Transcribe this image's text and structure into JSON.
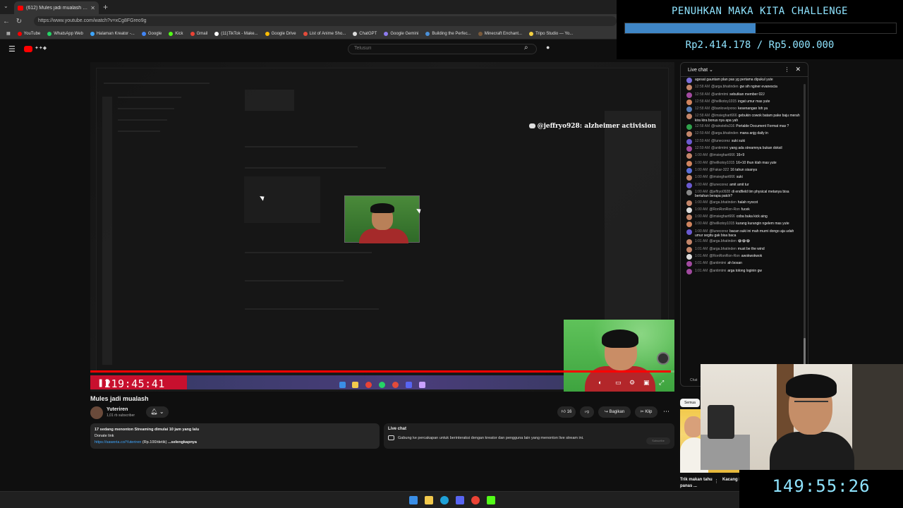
{
  "browser": {
    "tab_title": "(612) Mules jadi mualash - YouTube",
    "url": "https://www.youtube.com/watch?v=xCg8FGreo9g",
    "bookmarks": [
      {
        "label": "YouTube",
        "color": "#ff0000"
      },
      {
        "label": "WhatsApp Web",
        "color": "#25d366"
      },
      {
        "label": "Halaman Kreator -...",
        "color": "#3ea6ff"
      },
      {
        "label": "Google",
        "color": "#4285f4"
      },
      {
        "label": "Kick",
        "color": "#53fc18"
      },
      {
        "label": "Gmail",
        "color": "#ea4335"
      },
      {
        "label": "(11)TikTok - Make...",
        "color": "#ffffff"
      },
      {
        "label": "Google Drive",
        "color": "#fbbc04"
      },
      {
        "label": "List of Anime Sho...",
        "color": "#e34b3a"
      },
      {
        "label": "ChatGPT",
        "color": "#dddddd"
      },
      {
        "label": "Google Gemini",
        "color": "#8e7cf0"
      },
      {
        "label": "Building the Perfec...",
        "color": "#4a90d9"
      },
      {
        "label": "Minecraft Enchant...",
        "color": "#7a5a3a"
      },
      {
        "label": "Tripo Studio — Yo...",
        "color": "#f5d142"
      }
    ]
  },
  "youtube": {
    "search_placeholder": "Telusuri"
  },
  "video": {
    "overlay_name": "@jeffryo928: alzheimer activision",
    "timer": "219:45:41",
    "progress_fraction": 0.994,
    "title": "Mules jadi mualash",
    "channel_name": "Yuteriren",
    "channel_subs": "1,01 rb subscriber",
    "like_count": "16",
    "share_label": "Bagikan",
    "clip_label": "Klip",
    "description_line1": "17 sedang menonton  Streaming dimulai 10 jam yang lalu",
    "description_line2": "Donate link",
    "description_link": "https://saweria.co/Yuteriren",
    "description_link_suffix": "(Rp.100/detik)",
    "description_more": "...selengkapnya",
    "live_chat_heading": "Live chat",
    "live_chat_text": "Gabung ke percakapan untuk berinteraksi dengan kreator dan pengguna lain yang menonton live stream ini.",
    "subscribe_label": "Subscribe"
  },
  "chat": {
    "header": "Live chat",
    "messages": [
      {
        "time": "",
        "author": "",
        "text": "agesat gauntam plan pas yg pertama dipukul yute",
        "color": "#7c6fd8"
      },
      {
        "time": "12:58 AM",
        "author": "@arga.bhatinden",
        "text": "gw sih nginer evanescia",
        "color": "#c4866a"
      },
      {
        "time": "12:58 AM",
        "author": "@antimtmi",
        "text": "sebutkan member 02J",
        "color": "#a24aa0"
      },
      {
        "time": "12:58 AM",
        "author": "@hellkotoy1015",
        "text": "ingat umur mas yute",
        "color": "#d0845e"
      },
      {
        "time": "12:58 AM",
        "author": "@banlovelyxroo",
        "text": "kesenangan loh ya",
        "color": "#5a7fb8"
      },
      {
        "time": "12:58 AM",
        "author": "@imsieghart666",
        "text": "gebukin cowok batam pake baju merah kira kira bonus nya apa yah",
        "color": "#c4866a"
      },
      {
        "time": "12:58 AM",
        "author": "@rainstelis316",
        "text": "Portable Document Format mas ?",
        "color": "#2fa14b"
      },
      {
        "time": "12:59 AM",
        "author": "@arga.bhatinden",
        "text": "mana anjg daily in",
        "color": "#c4866a"
      },
      {
        "time": "12:59 AM",
        "author": "@lunecorez",
        "text": "suki suki",
        "color": "#6a5ad0"
      },
      {
        "time": "12:59 AM",
        "author": "@antimtmi",
        "text": "yang ada streamnya bukan doksil",
        "color": "#a24aa0"
      },
      {
        "time": "1:00 AM",
        "author": "@imsieghart666",
        "text": "16+9",
        "color": "#c4866a"
      },
      {
        "time": "1:00 AM",
        "author": "@hellkotoy1015",
        "text": "16+10 thun klah mas yute",
        "color": "#d0845e"
      },
      {
        "time": "1:00 AM",
        "author": "@Fakar-322",
        "text": "16 tahun sisanya",
        "color": "#5b6fd8"
      },
      {
        "time": "1:00 AM",
        "author": "@imsieghart666",
        "text": "suki",
        "color": "#c4866a"
      },
      {
        "time": "1:00 AM",
        "author": "@lunecorez",
        "text": "amit amit tur",
        "color": "#6a5ad0"
      },
      {
        "time": "1:00 AM",
        "author": "@jeffryo0928",
        "text": "di endfield tim physical metanya bisa bertahan berapa patch?",
        "color": "#888888"
      },
      {
        "time": "1:00 AM",
        "author": "@arga.bhatinden",
        "text": "halah nyocot",
        "color": "#c4866a"
      },
      {
        "time": "1:00 AM",
        "author": "@RonRonRon-Ron",
        "text": "fucek",
        "color": "#dddddd"
      },
      {
        "time": "1:00 AM",
        "author": "@imsieghart666",
        "text": "coba buka kick aing",
        "color": "#c4866a"
      },
      {
        "time": "1:00 AM",
        "author": "@hellkotoy1015",
        "text": "kurang kurangin ngelem mas yute",
        "color": "#d0845e"
      },
      {
        "time": "1:00 AM",
        "author": "@lunecorez",
        "text": "bacan suki ini mah murni dongo aja udah umur segitu gak bisa baca",
        "color": "#6a5ad0"
      },
      {
        "time": "1:01 AM",
        "author": "@arga.bhatinden",
        "text": "😂😂😂",
        "color": "#c4866a"
      },
      {
        "time": "1:01 AM",
        "author": "@arga.bhatinden",
        "text": "must be the wind",
        "color": "#c4866a"
      },
      {
        "time": "1:01 AM",
        "author": "@RonRonRon-Ron",
        "text": "awokwokwok",
        "color": "#dddddd"
      },
      {
        "time": "1:01 AM",
        "author": "@antimtmi",
        "text": "ah bosan",
        "color": "#a24aa0"
      },
      {
        "time": "1:01 AM",
        "author": "@antimtmi",
        "text": "arga tolong loginin gw",
        "color": "#a24aa0"
      }
    ],
    "chat_button_peek": "Chat"
  },
  "challenge": {
    "title": "PENUHKAN MAKA KITA CHALLENGE",
    "amount": "Rp2.414.178 / Rp5.000.000",
    "progress_fraction": 0.483,
    "bar_color": "#3f86c6",
    "text_color": "#8fe4ff"
  },
  "overlay_timer": "149:55:26",
  "recommendations": {
    "chip": "Semua",
    "item1_title": "Trik makan tahu panas ...",
    "item2_title": "Kacang karame..."
  },
  "taskbar": {
    "icons": [
      {
        "name": "windows-start-icon",
        "color": "#3a8ee6"
      },
      {
        "name": "file-explorer-icon",
        "color": "#f2c94c"
      },
      {
        "name": "edge-icon",
        "color": "#1fa1d8"
      },
      {
        "name": "discord-icon",
        "color": "#5865f2"
      },
      {
        "name": "chrome-icon",
        "color": "#ea4335"
      },
      {
        "name": "app-icon",
        "color": "#53fc18"
      }
    ]
  }
}
